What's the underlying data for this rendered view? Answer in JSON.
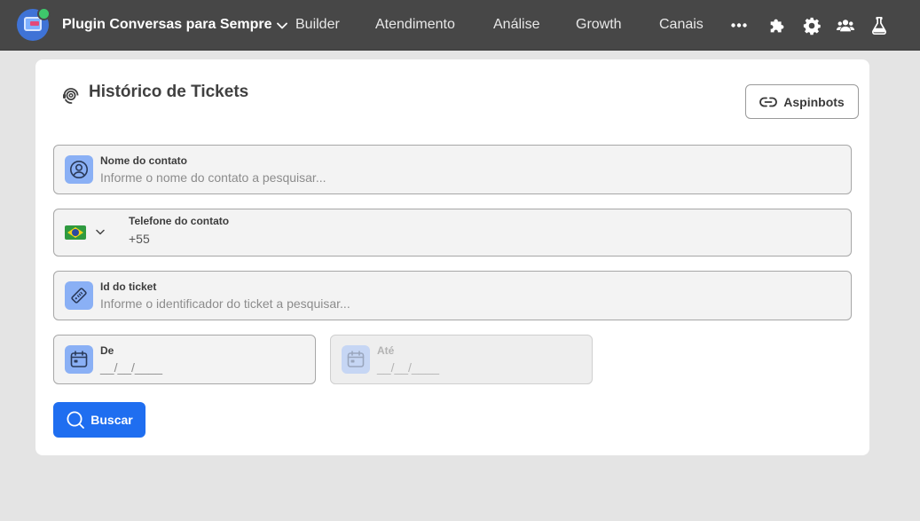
{
  "nav": {
    "workspace": "Plugin Conversas para Sempre",
    "items": [
      "Builder",
      "Atendimento",
      "Análise",
      "Growth",
      "Canais"
    ],
    "icons": [
      "more-icon",
      "puzzle-icon",
      "gear-icon",
      "users-icon",
      "flask-icon"
    ]
  },
  "page": {
    "title": "Histórico de Tickets",
    "aspinbots_button": "Aspinbots"
  },
  "form": {
    "contact_name": {
      "label": "Nome do contato",
      "placeholder": "Informe o nome do contato a pesquisar..."
    },
    "phone": {
      "label": "Telefone do contato",
      "value": "+55",
      "country": "BR"
    },
    "ticket_id": {
      "label": "Id do ticket",
      "placeholder": "Informe o identificador do ticket a pesquisar..."
    },
    "date_from": {
      "label": "De",
      "placeholder": "__/__/____"
    },
    "date_to": {
      "label": "Até",
      "placeholder": "__/__/____"
    },
    "search_button": "Buscar"
  },
  "colors": {
    "primary": "#1f6ef0",
    "icon_bg": "#8ab0f5",
    "topbar": "#474747",
    "status_dot": "#3ec76b"
  }
}
